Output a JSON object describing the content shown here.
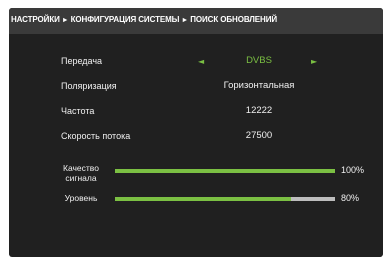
{
  "breadcrumb": {
    "items": [
      "НАСТРОЙКИ",
      "КОНФИГУРАЦИЯ СИСТЕМЫ",
      "ПОИСК ОБНОВЛЕНИЙ"
    ],
    "separator": "►"
  },
  "settings": {
    "transmission": {
      "label": "Передача",
      "value": "DVBS",
      "left_arrow": "◄",
      "right_arrow": "►"
    },
    "polarization": {
      "label": "Поляризация",
      "value": "Горизонтальная"
    },
    "frequency": {
      "label": "Частота",
      "value": "12222"
    },
    "symbol_rate": {
      "label": "Скорость потока",
      "value": "27500"
    }
  },
  "signal": {
    "quality": {
      "label_line1": "Качество",
      "label_line2": "сигнала",
      "value_text": "100%",
      "fraction": 1.0
    },
    "level": {
      "label": "Уровень",
      "value_text": "80%",
      "fraction": 0.8
    }
  },
  "colors": {
    "accent": "#7bc043",
    "background": "#202020",
    "header": "#3a3a3a",
    "bar_track": "#bdbdbd"
  }
}
